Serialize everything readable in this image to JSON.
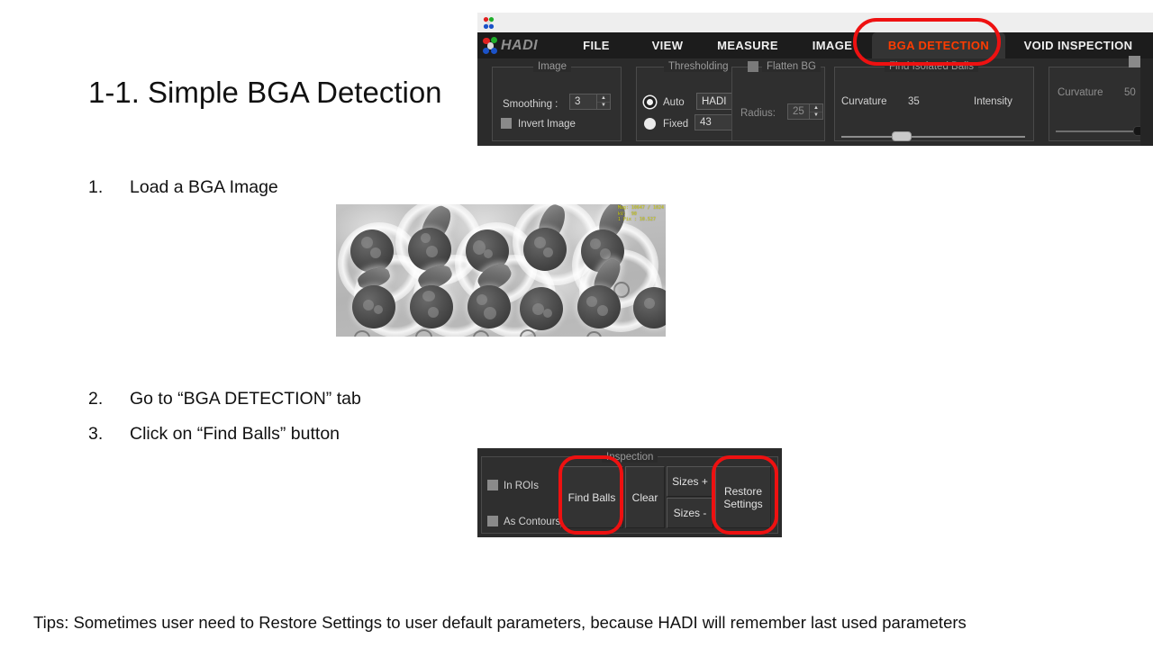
{
  "slide": {
    "title": "1-1. Simple BGA Detection",
    "steps": [
      {
        "num": "1.",
        "text": "Load a BGA Image"
      },
      {
        "num": "2.",
        "text": "Go to “BGA DETECTION” tab"
      },
      {
        "num": "3.",
        "text": "Click on “Find Balls” button"
      }
    ],
    "tips": "Tips: Sometimes user need to Restore Settings to user default parameters, because HADI will remember last used parameters"
  },
  "bga_image": {
    "alt": "BGA x-ray inspection image",
    "overlay_text": "Mag: 10647 / 1024\nkV:  90\n1 Pix : 10.527"
  },
  "toolbar": {
    "brand": "HADI",
    "tabs": [
      {
        "label": "FILE",
        "active": false
      },
      {
        "label": "VIEW",
        "active": false
      },
      {
        "label": "MEASURE",
        "active": false
      },
      {
        "label": "IMAGE",
        "active": false
      },
      {
        "label": "BGA DETECTION",
        "active": true
      },
      {
        "label": "VOID INSPECTION",
        "active": false
      }
    ],
    "groups": {
      "image": {
        "title": "Image",
        "smoothing_label": "Smoothing :",
        "smoothing_value": "3",
        "invert_label": "Invert Image",
        "invert_checked": false
      },
      "thresholding": {
        "title": "Thresholding",
        "auto_label": "Auto",
        "auto_selected": true,
        "auto_method": "HADI",
        "fixed_label": "Fixed",
        "fixed_selected": false,
        "fixed_value": "43"
      },
      "flatten_bg": {
        "title": "Flatten BG",
        "checked": false,
        "radius_label": "Radius:",
        "radius_value": "25"
      },
      "find_isolated_balls": {
        "title": "Find Isolated Balls",
        "curvature_label": "Curvature",
        "curvature_value": "35",
        "intensity_label": "Intensity",
        "slider_percent": 33
      },
      "right_group": {
        "title": "",
        "checked": false,
        "curvature_label": "Curvature",
        "curvature_value": "50",
        "slider_percent": 88
      }
    }
  },
  "inspection": {
    "title": "Inspection",
    "in_rois_label": "In ROIs",
    "in_rois_checked": false,
    "as_contours_label": "As Contours",
    "as_contours_checked": false,
    "find_balls_label": "Find Balls",
    "clear_label": "Clear",
    "sizes_plus_label": "Sizes +",
    "sizes_minus_label": "Sizes -",
    "restore_settings_label": "Restore\nSettings"
  },
  "annotations": {
    "highlight_color": "#ee1111",
    "boxes": [
      "bga-detection-tab",
      "find-balls-button",
      "restore-settings-button"
    ]
  },
  "colors": {
    "accent_orange": "#ff3c00",
    "toolbar_bg": "#2b2b2b",
    "menu_bg": "#1c1c1c",
    "text_light": "#e2e2e2"
  }
}
